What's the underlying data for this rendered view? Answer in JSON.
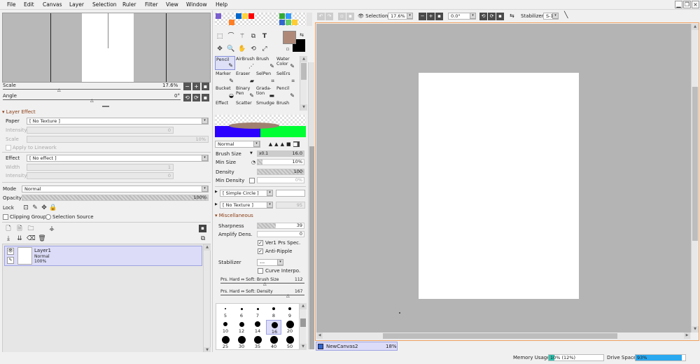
{
  "menu": [
    "File",
    "Edit",
    "Canvas",
    "Layer",
    "Selection",
    "Ruler",
    "Filter",
    "View",
    "Window",
    "Help"
  ],
  "navigator": {
    "scale_label": "Scale",
    "scale_value": "17.6%",
    "angle_label": "Angle",
    "angle_value": "0°"
  },
  "layer_effect": {
    "title": "Layer Effect",
    "paper_label": "Paper",
    "paper_value": "[ No Texture ]",
    "intensity_label": "Intensity",
    "intensity_value": "0",
    "scale_label": "Scale",
    "scale_value": "10%",
    "apply_label": "Apply to Linework",
    "effect_label": "Effect",
    "effect_value": "[ No effect ]",
    "width_label": "Width",
    "width_value": "1",
    "intensity2_label": "Intensity",
    "intensity2_value": "0"
  },
  "layer_props": {
    "mode_label": "Mode",
    "mode_value": "Normal",
    "opacity_label": "Opacity",
    "opacity_value": "100%",
    "lock_label": "Lock",
    "clipping_label": "Clipping Group",
    "selection_source_label": "Selection Source"
  },
  "layers": [
    {
      "name": "Layer1",
      "mode": "Normal",
      "opacity": "100%"
    }
  ],
  "tool_panel": {
    "swatch_colors": [
      "#7a5fcf",
      "#ffffff",
      "#ff7f27",
      "#0066cc",
      "#ffd33d",
      "#ff0000",
      "#33aa33",
      "#3399ff",
      "#ffffff",
      "#cccccc"
    ],
    "fg_color": "#b08878",
    "bg_color": "#000000",
    "tools_text_icon": "T"
  },
  "brushes": [
    {
      "name": "Pencil",
      "icon": "✎",
      "selected": true
    },
    {
      "name": "AirBrush",
      "icon": "⋰"
    },
    {
      "name": "Brush",
      "icon": "✎"
    },
    {
      "name": "Water Color",
      "icon": "✎"
    },
    {
      "name": "Marker",
      "icon": "✎"
    },
    {
      "name": "Eraser",
      "icon": "▰"
    },
    {
      "name": "SelPen",
      "icon": "⌗"
    },
    {
      "name": "SelErs",
      "icon": "⌗"
    },
    {
      "name": "Bucket",
      "icon": "◒"
    },
    {
      "name": "Binary Pen",
      "icon": "✎"
    },
    {
      "name": "Grada-tion",
      "icon": "▬"
    },
    {
      "name": "Pencil",
      "icon": "✎"
    },
    {
      "name": "Effect",
      "icon": ""
    },
    {
      "name": "Scatter",
      "icon": ""
    },
    {
      "name": "Smudge",
      "icon": ""
    },
    {
      "name": "Brush",
      "icon": ""
    }
  ],
  "brush_settings": {
    "blend_mode": "Normal",
    "brush_size_label": "Brush Size",
    "brush_size_mult": "x0.1",
    "brush_size_value": "16.0",
    "min_size_label": "Min Size",
    "min_size_value": "10%",
    "density_label": "Density",
    "density_value": "100",
    "min_density_label": "Min Density",
    "min_density_value": "0%",
    "shape_value": "[ Simple Circle ]",
    "texture_value": "[ No Texture ]",
    "texture_strength": "95",
    "misc_label": "Miscellaneous",
    "sharpness_label": "Sharpness",
    "sharpness_value": "39",
    "amplify_label": "Amplify Dens.",
    "amplify_value": "0",
    "ver1_label": "Ver1 Prs Spec.",
    "anti_ripple_label": "Anti-Ripple",
    "stabilizer_label": "Stabilizer",
    "stabilizer_value": "---",
    "curve_label": "Curve Interpo.",
    "prs_size_label": "Prs. Hard ⇔ Soft: Brush Size",
    "prs_size_value": "112",
    "prs_density_label": "Prs. Hard ⇔ Soft: Density",
    "prs_density_value": "167"
  },
  "dot_sizes": [
    "5",
    "6",
    "7",
    "8",
    "9",
    "10",
    "12",
    "14",
    "16",
    "20",
    "25",
    "30",
    "35",
    "40",
    "50"
  ],
  "canvas_toolbar": {
    "selection_label": "Selection",
    "zoom_value": "17.6%",
    "angle_value": "0.0°",
    "stabilizer_label": "Stabilizer",
    "stabilizer_value": "S-1"
  },
  "canvas_tab": {
    "name": "NewCanvas2",
    "zoom": "18%"
  },
  "status": {
    "memory_label": "Memory Usage",
    "memory_value": "10% (12%)",
    "memory_fill": 0.1,
    "drive_label": "Drive Space",
    "drive_value": "93%",
    "drive_fill": 0.93
  }
}
